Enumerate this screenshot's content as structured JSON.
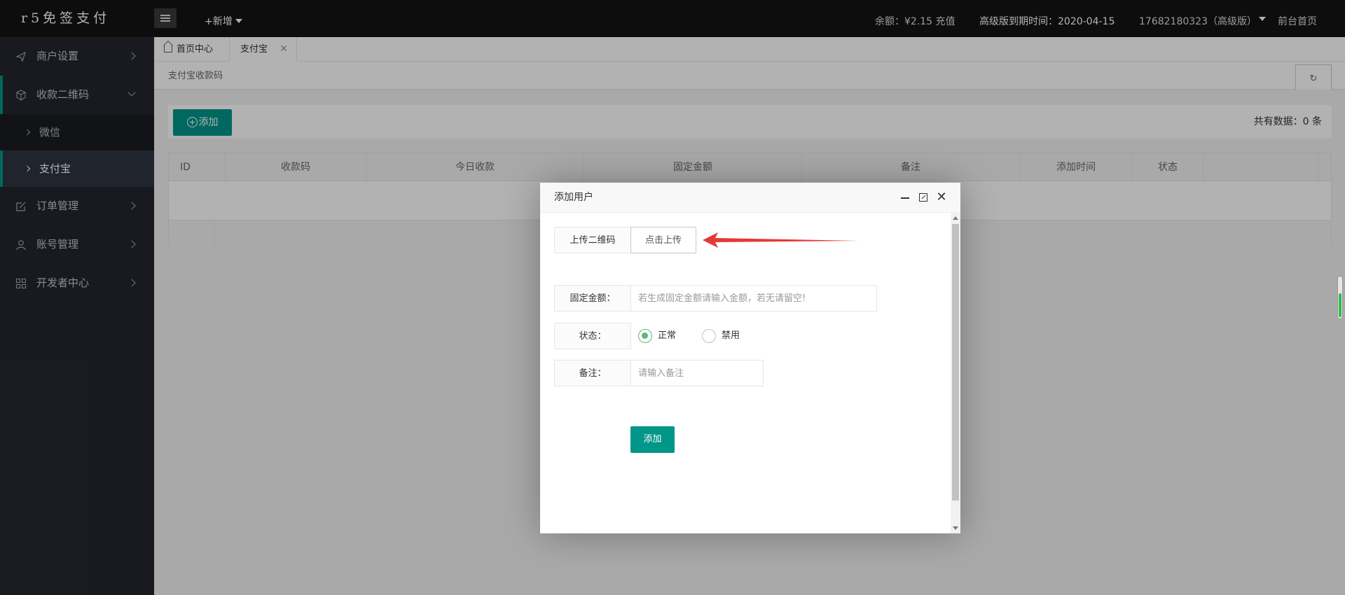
{
  "app": {
    "logo": "r5免签支付",
    "new_label": "+新增"
  },
  "topbar": {
    "balance": "余额：¥2.15 充值",
    "expire": "高级版到期时间：2020-04-15",
    "user": "17682180323（高级版）",
    "front_link": "前台首页"
  },
  "sidebar": {
    "items": [
      {
        "label": "商户设置",
        "icon": "send-icon"
      },
      {
        "label": "收款二维码",
        "icon": "cube-icon",
        "expanded": true
      },
      {
        "label": "订单管理",
        "icon": "edit-icon"
      },
      {
        "label": "账号管理",
        "icon": "user-icon"
      },
      {
        "label": "开发者中心",
        "icon": "grid-icon"
      }
    ],
    "sub_items": [
      {
        "label": "微信",
        "active": false
      },
      {
        "label": "支付宝",
        "active": true
      }
    ]
  },
  "tabs": [
    {
      "label": "首页中心",
      "icon": "home-icon"
    },
    {
      "label": "支付宝",
      "closable": true,
      "close": "✕"
    }
  ],
  "content": {
    "breadcrumb": "支付宝收款码",
    "refresh_icon": "↻",
    "add_button": "添加",
    "total": "共有数据：0 条",
    "table": {
      "headers": [
        "ID",
        "收款码",
        "今日收款",
        "固定金额",
        "备注",
        "添加时间",
        "状态"
      ]
    }
  },
  "modal": {
    "title": "添加用户",
    "close": "✕",
    "upload_label": "上传二维码",
    "upload_button": "点击上传",
    "amount_label": "固定金额：",
    "amount_placeholder": "若生成固定金额请输入金额，若无请留空!",
    "status_label": "状态：",
    "status_options": [
      {
        "label": "正常",
        "checked": true
      },
      {
        "label": "禁用",
        "checked": false
      }
    ],
    "remark_label": "备注：",
    "remark_placeholder": "请输入备注",
    "submit": "添加"
  },
  "colors": {
    "accent": "#009688",
    "radio_on": "#5fb878",
    "annotation_arrow": "#e53935",
    "topbar_bg": "#141414",
    "sidebar_bg": "#23262e"
  }
}
